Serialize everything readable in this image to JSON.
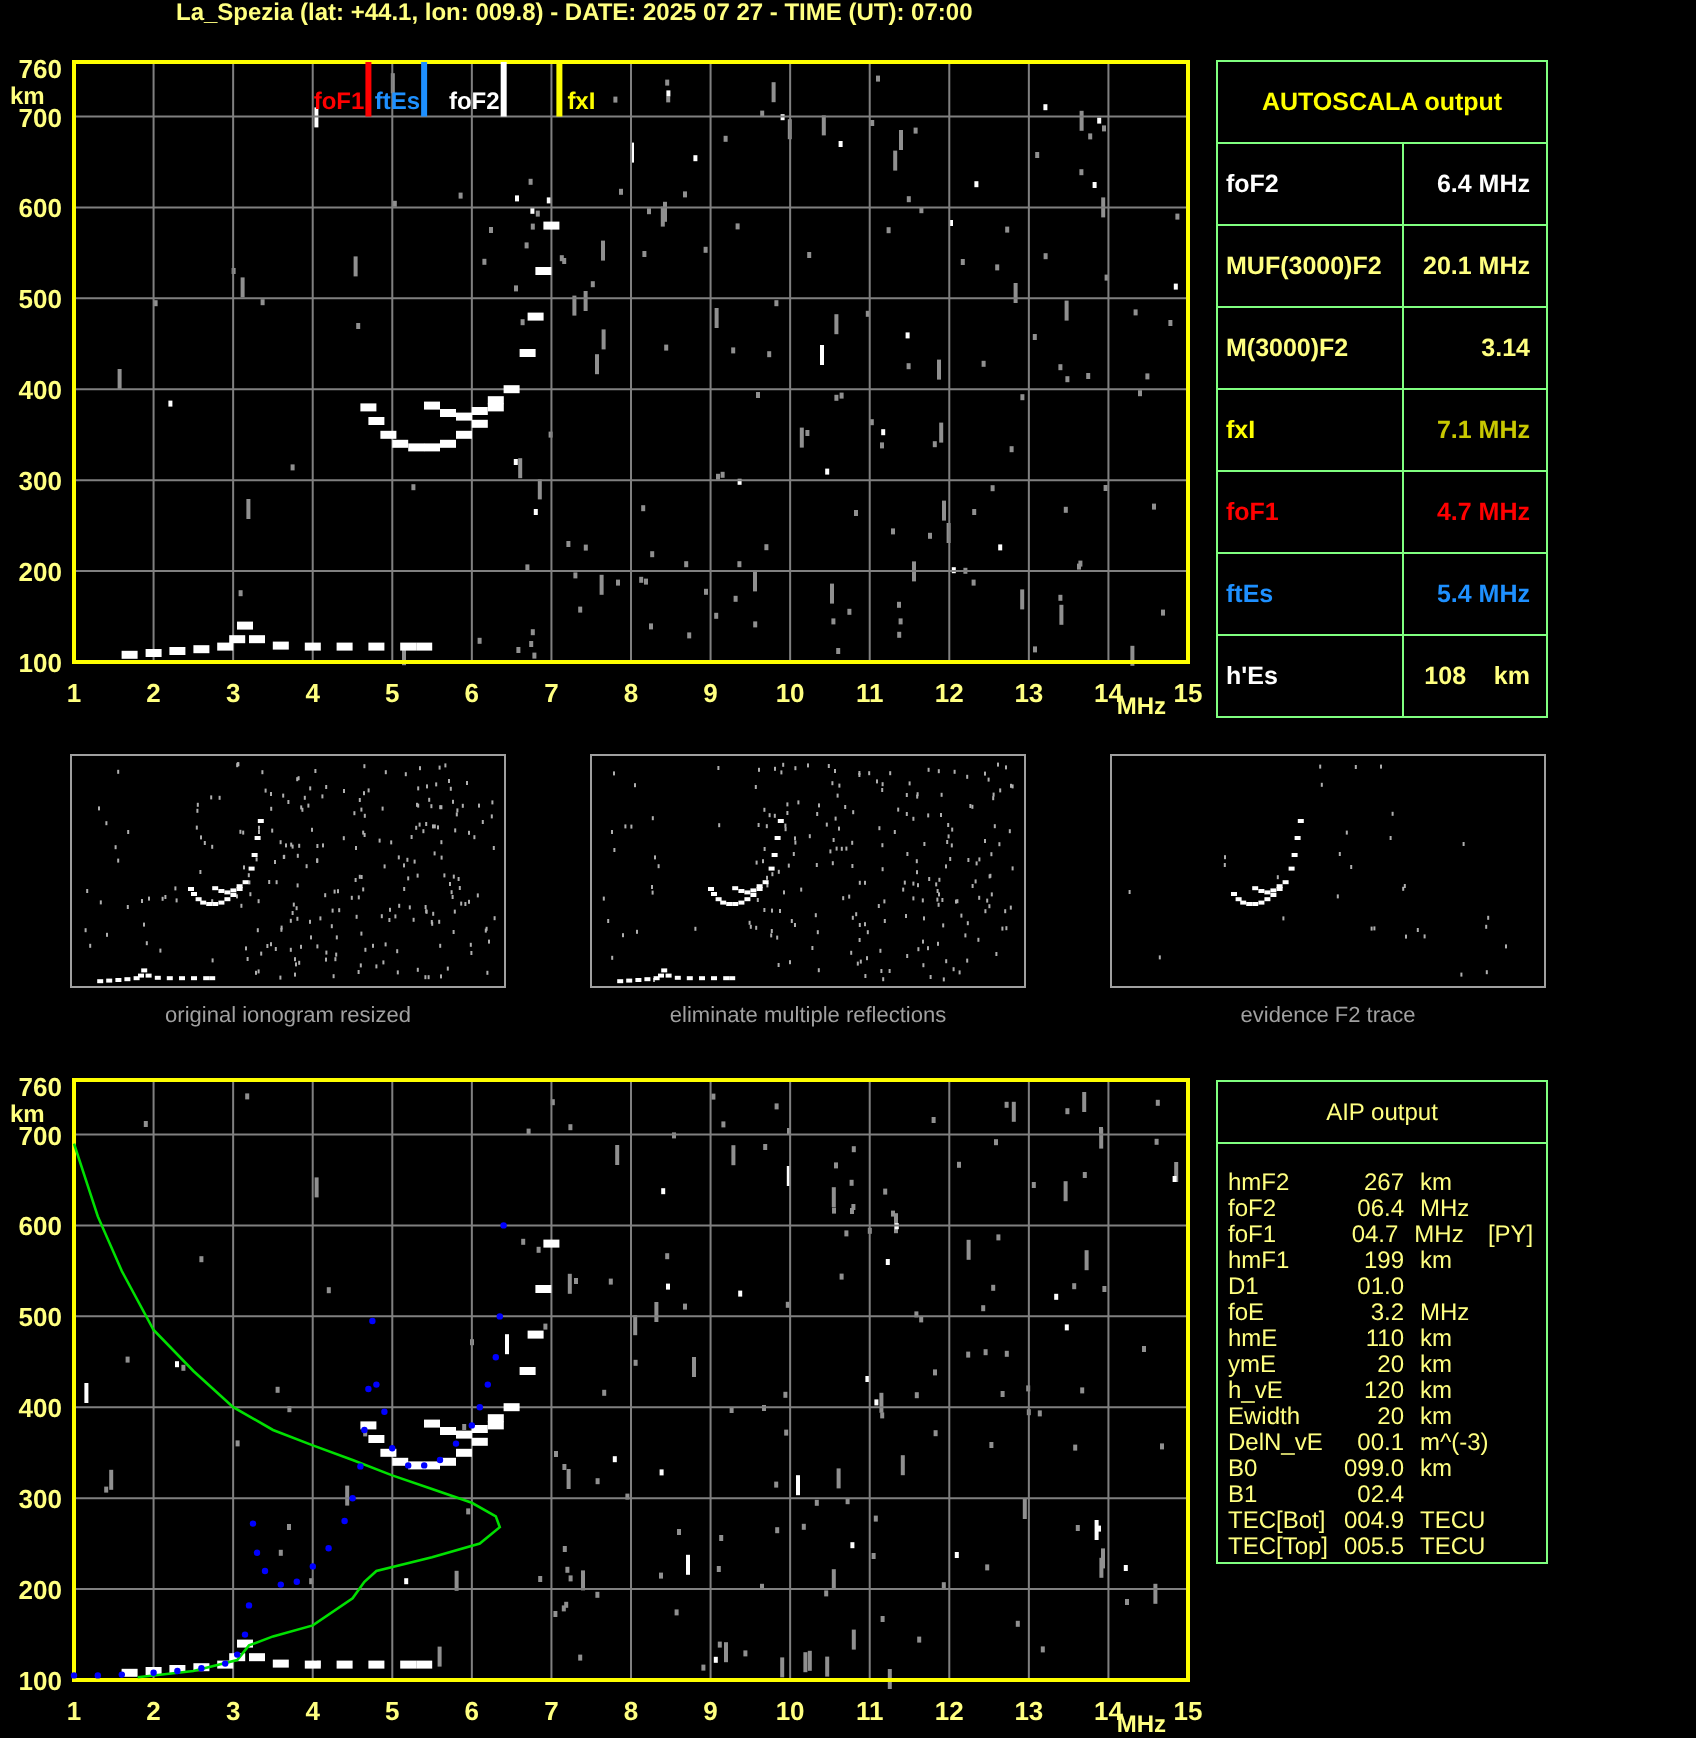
{
  "title": "La_Spezia (lat: +44.1, lon: 009.8) - DATE: 2025 07 27 - TIME (UT): 07:00",
  "ionogram": {
    "chart_data": {
      "type": "scatter",
      "xlabel": "MHz",
      "ylabel": "km",
      "xlim": [
        1,
        15
      ],
      "ylim": [
        100,
        760
      ],
      "xticks": [
        1,
        2,
        3,
        4,
        5,
        6,
        7,
        8,
        9,
        10,
        11,
        12,
        13,
        14,
        15
      ],
      "yticks": [
        100,
        200,
        300,
        400,
        500,
        600,
        700,
        760
      ],
      "grid": true,
      "series": [
        {
          "color": "#ffffff",
          "x": [
            1.7,
            2.0,
            2.3,
            2.6,
            2.9,
            3.05,
            3.15,
            3.3,
            3.6,
            4.0,
            4.4,
            4.8,
            5.2,
            5.4,
            4.7,
            4.8,
            4.95,
            5.1,
            5.3,
            5.5,
            5.7,
            5.9,
            6.1,
            6.3,
            6.5,
            6.7,
            6.8,
            6.9,
            7.0,
            5.5,
            5.7,
            5.9,
            6.1,
            6.3
          ],
          "values": [
            108,
            110,
            112,
            114,
            117,
            125,
            140,
            125,
            118,
            117,
            117,
            117,
            117,
            117,
            380,
            365,
            350,
            340,
            336,
            336,
            340,
            350,
            362,
            380,
            400,
            440,
            480,
            530,
            580,
            382,
            374,
            370,
            376,
            388
          ]
        }
      ],
      "ref_lines": [
        {
          "axis": "x",
          "value": 4.7,
          "label": "foF1",
          "color": "#ff0000"
        },
        {
          "axis": "x",
          "value": 5.4,
          "label": "ftEs",
          "color": "#1e90ff"
        },
        {
          "axis": "x",
          "value": 6.4,
          "label": "foF2",
          "color": "#ffffff"
        },
        {
          "axis": "x",
          "value": 7.1,
          "label": "fxI",
          "color": "#ffff00"
        }
      ]
    }
  },
  "autoscala": {
    "heading": "AUTOSCALA output",
    "rows": [
      {
        "label": {
          "text": "foF2",
          "color": "#ffffff"
        },
        "value": {
          "text": "6.4 MHz",
          "color": "#ffffff"
        }
      },
      {
        "label": {
          "text": "MUF(3000)F2",
          "color": "#ffff80"
        },
        "value": {
          "text": "20.1 MHz",
          "color": "#ffff80"
        }
      },
      {
        "label": {
          "text": "M(3000)F2",
          "color": "#ffff80"
        },
        "value": {
          "text": "3.14",
          "color": "#ffff80"
        }
      },
      {
        "label": {
          "text": "fxI",
          "color": "#ffff00"
        },
        "value": {
          "text": "7.1 MHz",
          "color": "#c8c800"
        }
      },
      {
        "label": {
          "text": "foF1",
          "color": "#ff0000"
        },
        "value": {
          "text": "4.7 MHz",
          "color": "#ff0000"
        }
      },
      {
        "label": {
          "text": "ftEs",
          "color": "#1e90ff"
        },
        "value": {
          "text": "5.4 MHz",
          "color": "#1e90ff"
        }
      },
      {
        "label": {
          "text": "h'Es",
          "color": "#ffffff"
        },
        "value": {
          "text": "108    km",
          "color": "#ffff80"
        }
      }
    ]
  },
  "thumbnails": [
    {
      "caption": "original ionogram resized",
      "kind": "original"
    },
    {
      "caption": "eliminate multiple reflections",
      "kind": "filtered"
    },
    {
      "caption": "evidence F2 trace",
      "kind": "f2-trace"
    }
  ],
  "profile_plot": {
    "chart_data": {
      "type": "scatter",
      "xlabel": "MHz",
      "ylabel": "km",
      "xlim": [
        1,
        15
      ],
      "ylim": [
        100,
        760
      ],
      "xticks": [
        1,
        2,
        3,
        4,
        5,
        6,
        7,
        8,
        9,
        10,
        11,
        12,
        13,
        14,
        15
      ],
      "yticks": [
        100,
        200,
        300,
        400,
        500,
        600,
        700,
        760
      ],
      "grid": true,
      "series": [
        {
          "color": "#ffffff",
          "x": [
            1.7,
            2.0,
            2.3,
            2.6,
            2.9,
            3.05,
            3.15,
            3.3,
            3.6,
            4.0,
            4.4,
            4.8,
            5.2,
            5.4,
            4.7,
            4.8,
            4.95,
            5.1,
            5.3,
            5.5,
            5.7,
            5.9,
            6.1,
            6.3,
            6.5,
            6.7,
            6.8,
            6.9,
            7.0,
            5.5,
            5.7,
            5.9,
            6.1,
            6.3
          ],
          "values": [
            108,
            110,
            112,
            114,
            117,
            125,
            140,
            125,
            118,
            117,
            117,
            117,
            117,
            117,
            380,
            365,
            350,
            340,
            336,
            336,
            340,
            350,
            362,
            380,
            400,
            440,
            480,
            530,
            580,
            382,
            374,
            370,
            376,
            388
          ]
        },
        {
          "type": "line",
          "color": "#00e000",
          "x": [
            1.0,
            1.3,
            1.6,
            2.0,
            2.5,
            3.0,
            3.5,
            4.0,
            4.5,
            5.0,
            5.5,
            6.0,
            6.3,
            6.35,
            6.1,
            5.5,
            4.8,
            4.65,
            4.5,
            4.0,
            3.5,
            3.2,
            3.05,
            2.5,
            1.8
          ],
          "values": [
            690,
            610,
            550,
            485,
            440,
            400,
            375,
            358,
            342,
            325,
            310,
            295,
            280,
            268,
            250,
            235,
            220,
            208,
            190,
            160,
            148,
            138,
            122,
            110,
            103
          ]
        },
        {
          "color": "#0000ff",
          "x": [
            1.0,
            1.3,
            1.6,
            2.0,
            2.3,
            2.6,
            2.9,
            3.05,
            3.15,
            3.2,
            3.25,
            3.3,
            3.4,
            3.6,
            3.8,
            4.0,
            4.2,
            4.4,
            4.5,
            4.6,
            4.65,
            4.7,
            4.75,
            4.8,
            4.9,
            5.0,
            5.2,
            5.4,
            5.6,
            5.8,
            6.0,
            6.1,
            6.2,
            6.3,
            6.35,
            6.4
          ],
          "values": [
            105,
            105,
            106,
            108,
            110,
            113,
            118,
            128,
            150,
            182,
            272,
            240,
            220,
            205,
            208,
            225,
            245,
            275,
            300,
            335,
            375,
            420,
            495,
            425,
            395,
            355,
            336,
            336,
            342,
            360,
            380,
            400,
            425,
            455,
            500,
            600
          ]
        }
      ]
    }
  },
  "aip": {
    "heading": "AIP output",
    "rows": [
      {
        "name": "hmF2",
        "value": "267",
        "unit": "km"
      },
      {
        "name": "foF2",
        "value": "06.4",
        "unit": "MHz"
      },
      {
        "name": "foF1",
        "value": "04.7",
        "unit": "MHz",
        "flag": "[PY]"
      },
      {
        "name": "hmF1",
        "value": "199",
        "unit": "km"
      },
      {
        "name": "D1",
        "value": "01.0"
      },
      {
        "name": "foE",
        "value": "3.2",
        "unit": "MHz"
      },
      {
        "name": "hmE",
        "value": "110",
        "unit": "km"
      },
      {
        "name": "ymE",
        "value": "20",
        "unit": "km"
      },
      {
        "name": "h_vE",
        "value": "120",
        "unit": "km"
      },
      {
        "name": "Ewidth",
        "value": "20",
        "unit": "km"
      },
      {
        "name": "DelN_vE",
        "value": "00.1",
        "unit": "m^(-3)"
      },
      {
        "name": "B0",
        "value": "099.0",
        "unit": "km"
      },
      {
        "name": "B1",
        "value": "02.4"
      },
      {
        "name": "TEC[Bot]",
        "value": "004.9",
        "unit": "TECU"
      },
      {
        "name": "TEC[Top]",
        "value": "005.5",
        "unit": "TECU"
      }
    ]
  }
}
